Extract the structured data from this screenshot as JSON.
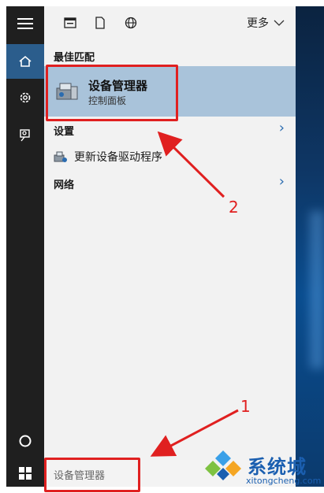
{
  "menu": {
    "more_label": "更多"
  },
  "sections": {
    "best_match": "最佳匹配",
    "settings": "设置",
    "network": "网络"
  },
  "best_result": {
    "title": "设备管理器",
    "subtitle": "控制面板"
  },
  "settings_items": [
    {
      "label": "更新设备驱动程序"
    }
  ],
  "search": {
    "value": "设备管理器"
  },
  "annotations": {
    "step1": "1",
    "step2": "2",
    "accent": "#e02020"
  },
  "watermark": {
    "brand": "系统城",
    "domain": "xitongcheng.com"
  },
  "colors": {
    "rail": "#1f1f1f",
    "highlight": "#a9c3da",
    "active": "#2b5d8c"
  },
  "icons": [
    "hamburger-icon",
    "home-icon",
    "gear-icon",
    "feedback-icon",
    "cortana-icon",
    "windows-icon",
    "app-icon",
    "document-icon",
    "globe-icon",
    "device-manager-icon",
    "driver-update-icon"
  ]
}
